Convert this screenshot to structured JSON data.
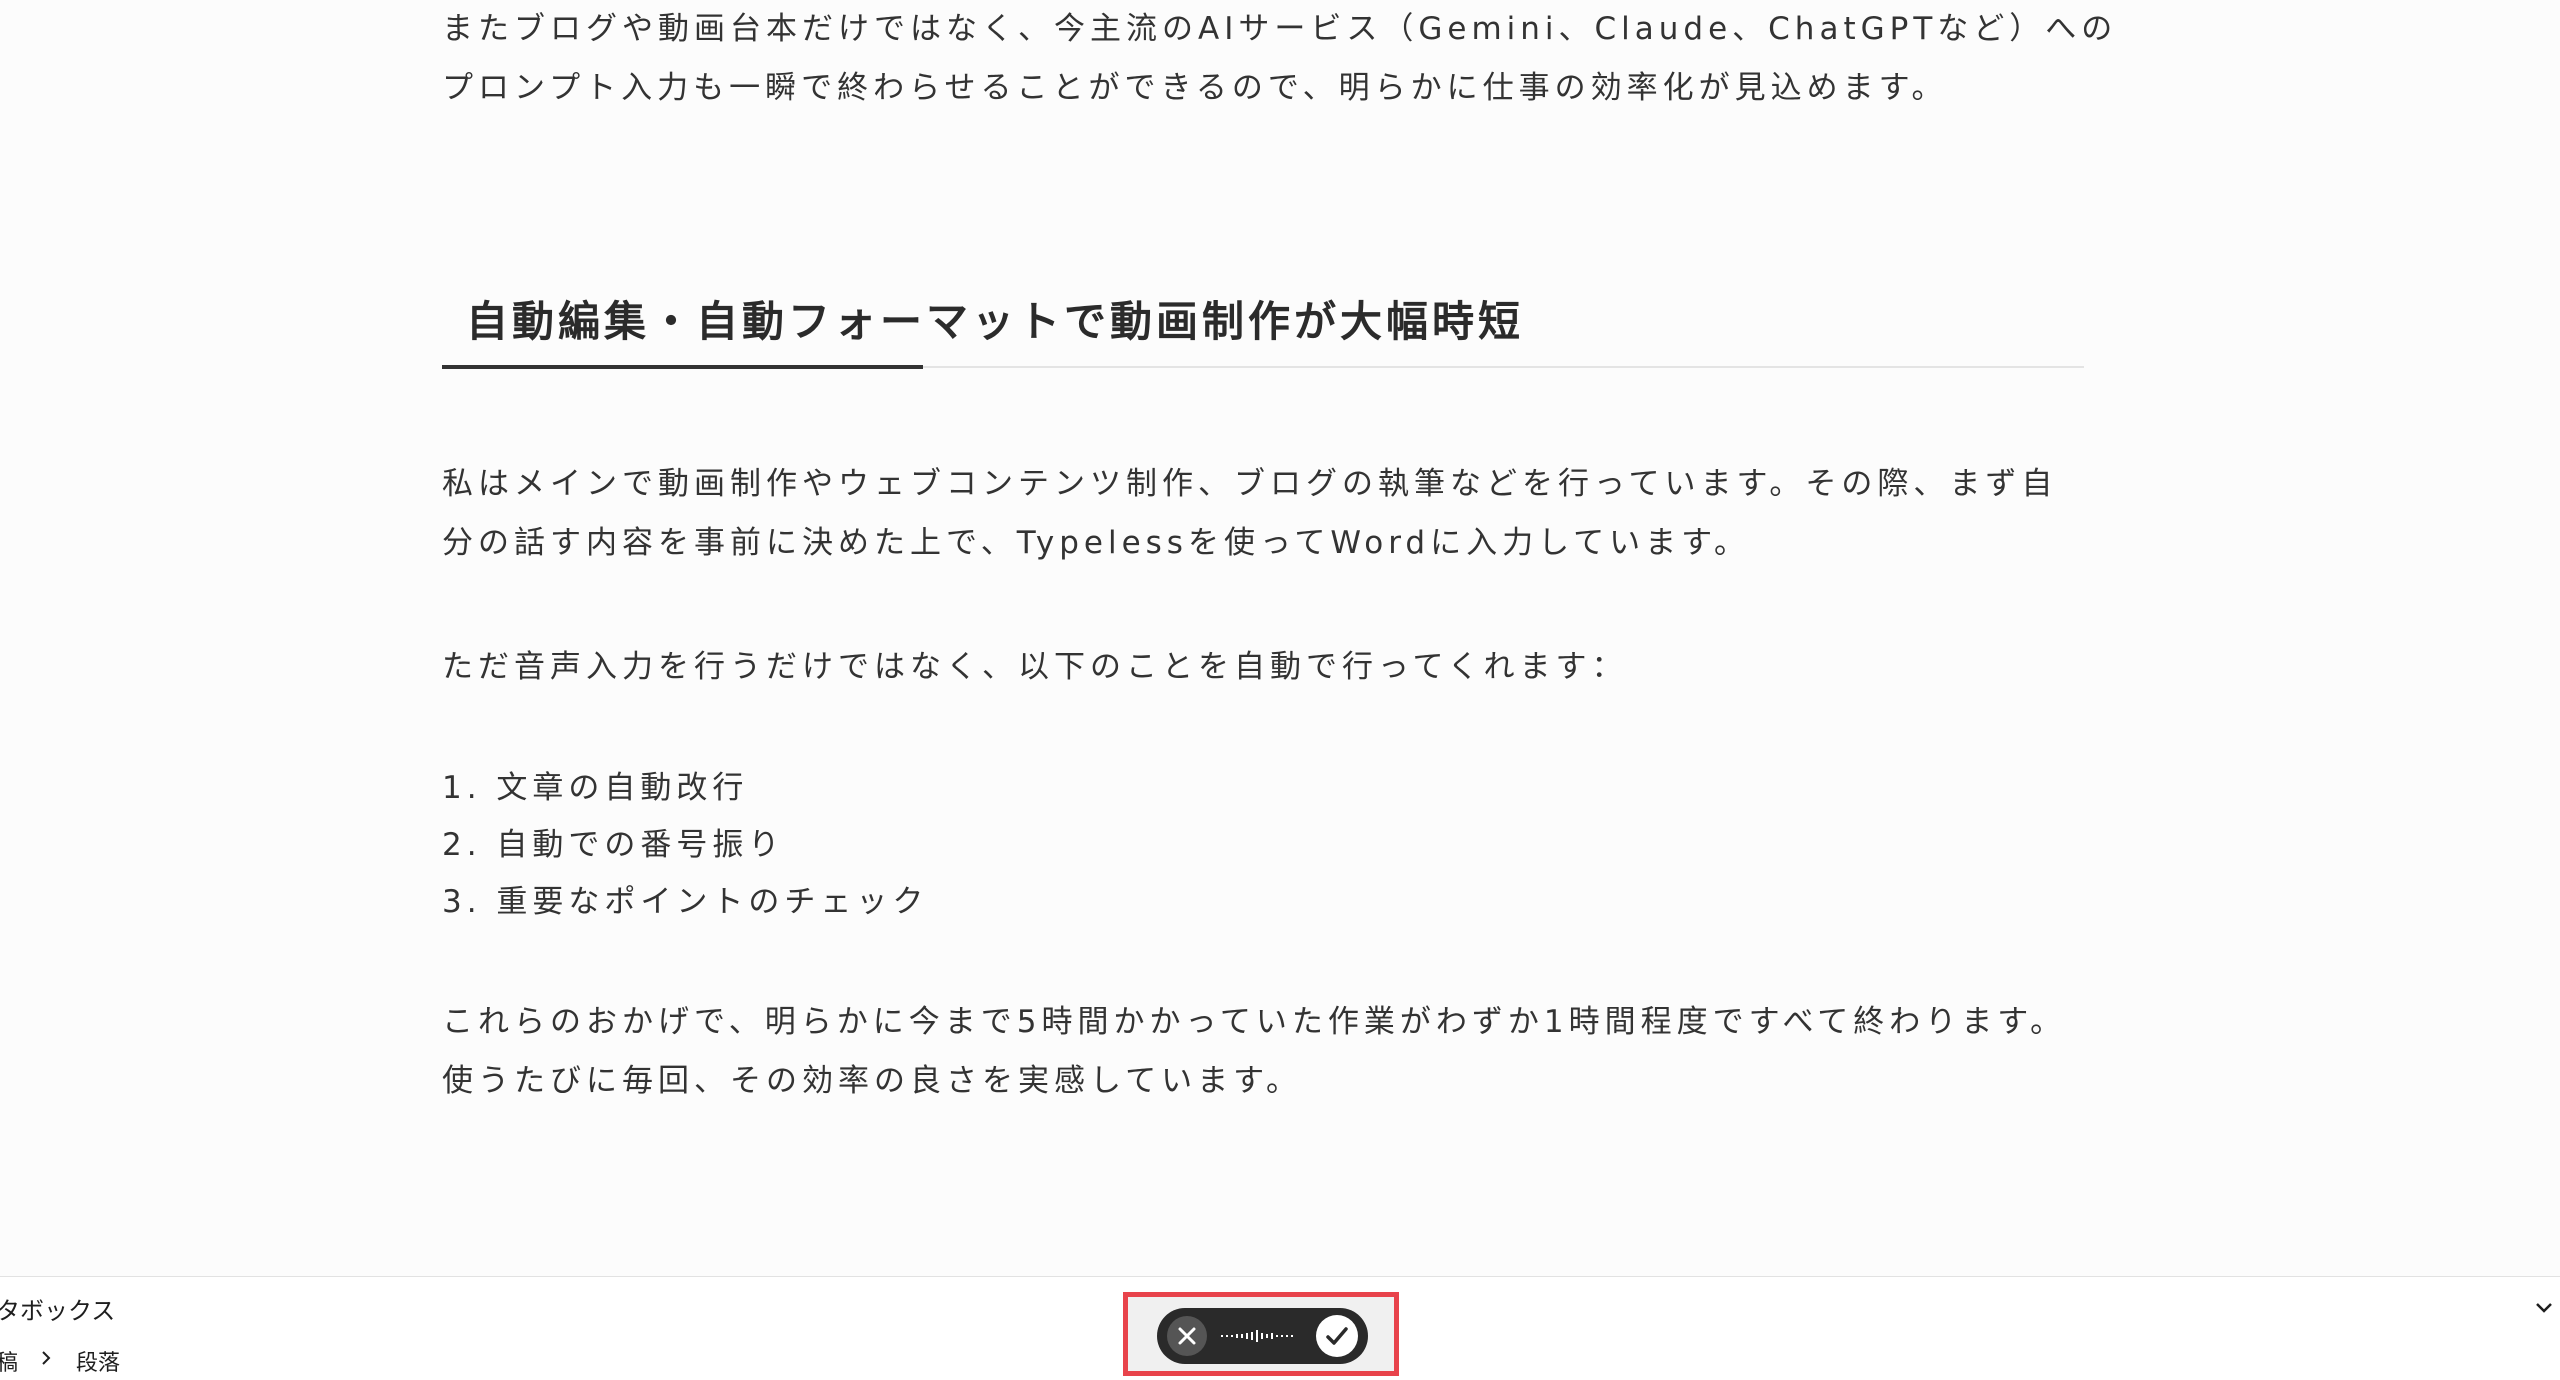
{
  "article": {
    "intro_line1": "またブログや動画台本だけではなく、今主流のAIサービス（Gemini、Claude、ChatGPTなど）への",
    "intro_line2": "プロンプト入力も一瞬で終わらせることができるので、明らかに仕事の効率化が見込めます。",
    "heading": "自動編集・自動フォーマットで動画制作が大幅時短",
    "para1_line1": "私はメインで動画制作やウェブコンテンツ制作、ブログの執筆などを行っています。その際、まず自",
    "para1_line2": "分の話す内容を事前に決めた上で、Typelessを使ってWordに入力しています。",
    "para2": "ただ音声入力を行うだけではなく、以下のことを自動で行ってくれます：",
    "list": [
      "1. 文章の自動改行",
      "2. 自動での番号振り",
      "3. 重要なポイントのチェック"
    ],
    "para3_line1": "これらのおかげで、明らかに今まで5時間かかっていた作業がわずか1時間程度ですべて終わります。",
    "para3_line2": "使うたびに毎回、その効率の良さを実感しています。"
  },
  "editor_bar": {
    "meta_box_label": "タボックス",
    "breadcrumb": [
      "稿",
      "段落"
    ]
  },
  "voice_widget": {
    "cancel_icon": "close-icon",
    "confirm_icon": "check-icon",
    "highlight_color": "#e8434b"
  }
}
